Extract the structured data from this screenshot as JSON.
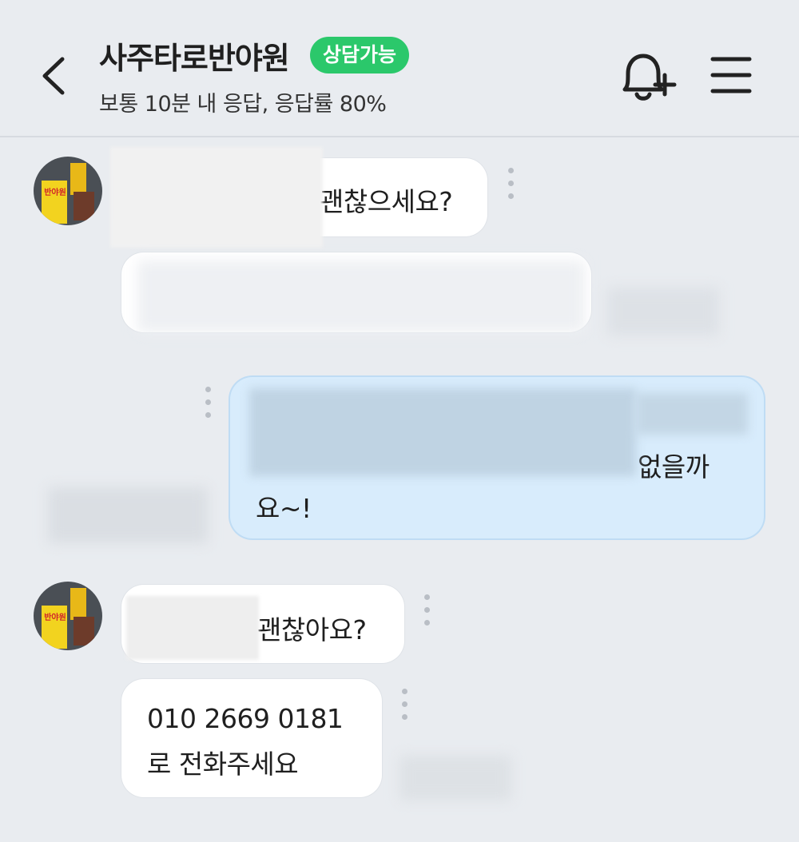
{
  "header": {
    "title": "사주타로반야원",
    "badge": "상담가능",
    "subtitle": "보통 10분 내 응답, 응답률 80%",
    "icons": [
      "back-arrow-icon",
      "bell-plus-icon",
      "hamburger-menu-icon"
    ]
  },
  "messages": [
    {
      "sender": "other",
      "text": "괜찮으세요?"
    },
    {
      "sender": "me",
      "text_line1": "없을까",
      "text_line2": "요~!"
    },
    {
      "sender": "other",
      "text": "괜찮아요?"
    },
    {
      "sender": "other",
      "text_line1": "010 2669 0181",
      "text_line2": "로 전화주세요"
    }
  ],
  "avatar": {
    "sign_text": "반야원"
  },
  "colors": {
    "accent": "#2bc86b",
    "my_bubble": "#d8ecfc",
    "background": "#e9ecf0"
  }
}
